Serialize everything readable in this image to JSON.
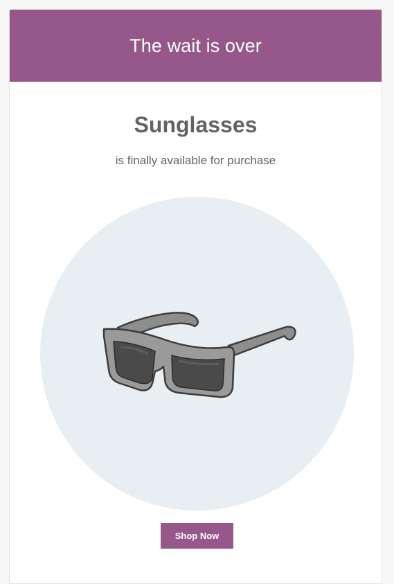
{
  "header": {
    "title": "The wait is over"
  },
  "product": {
    "name": "Sunglasses",
    "tagline": "is finally available for purchase",
    "image_icon": "sunglasses-illustration"
  },
  "cta": {
    "label": "Shop Now"
  },
  "colors": {
    "brand": "#96588a",
    "text": "#636363",
    "circle_bg": "#e9eef3"
  }
}
